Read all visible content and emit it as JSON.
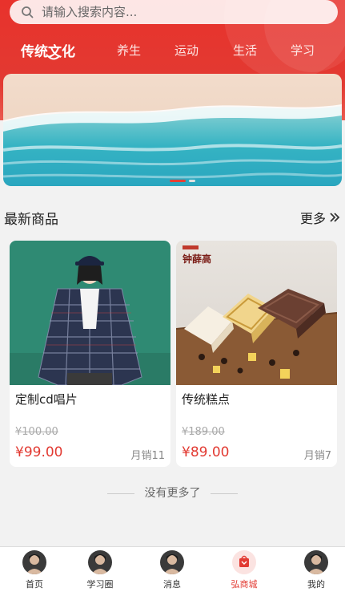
{
  "search": {
    "placeholder": "请输入搜索内容..."
  },
  "tabs": [
    {
      "label": "传统文化",
      "active": true
    },
    {
      "label": "养生",
      "active": false
    },
    {
      "label": "运动",
      "active": false
    },
    {
      "label": "生活",
      "active": false
    },
    {
      "label": "学习",
      "active": false
    }
  ],
  "banner": {
    "slides": 2,
    "active_slide": 1
  },
  "section": {
    "title": "最新商品",
    "more_label": "更多"
  },
  "products": [
    {
      "name": "定制cd唱片",
      "old_price": "¥100.00",
      "price": "¥99.00",
      "sales": "月销11"
    },
    {
      "name": "传统糕点",
      "old_price": "¥189.00",
      "price": "¥89.00",
      "sales": "月销7",
      "brand_text": "钟薛高"
    }
  ],
  "end_text": "没有更多了",
  "tabbar": [
    {
      "label": "首页",
      "icon": "avatar-icon",
      "active": false
    },
    {
      "label": "学习圈",
      "icon": "avatar-icon",
      "active": false
    },
    {
      "label": "消息",
      "icon": "avatar-icon",
      "active": false
    },
    {
      "label": "弘商城",
      "icon": "mall-icon",
      "active": true
    },
    {
      "label": "我的",
      "icon": "avatar-icon",
      "active": false
    }
  ],
  "colors": {
    "brand": "#e23a32",
    "background": "#f2f2f2"
  }
}
